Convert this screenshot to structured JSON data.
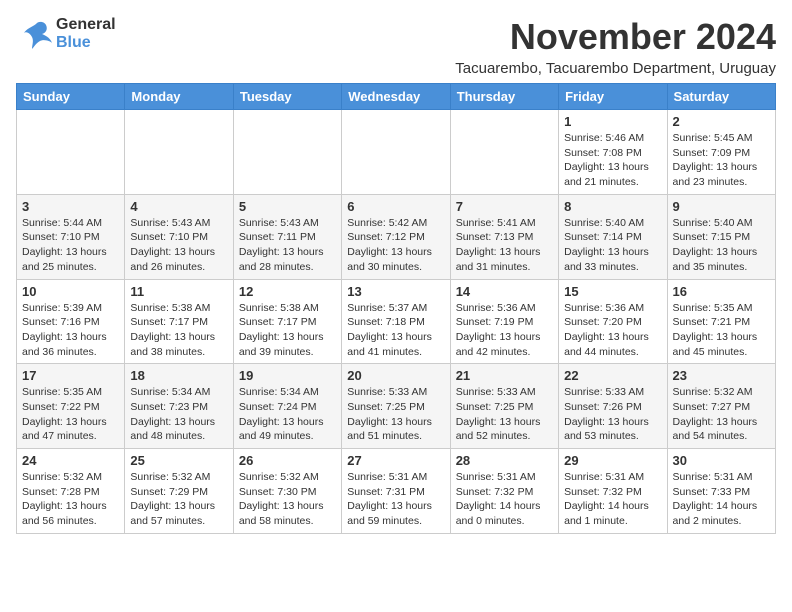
{
  "logo": {
    "line1": "General",
    "line2": "Blue"
  },
  "title": "November 2024",
  "subtitle": "Tacuarembo, Tacuarembo Department, Uruguay",
  "days_of_week": [
    "Sunday",
    "Monday",
    "Tuesday",
    "Wednesday",
    "Thursday",
    "Friday",
    "Saturday"
  ],
  "weeks": [
    [
      {
        "day": "",
        "info": ""
      },
      {
        "day": "",
        "info": ""
      },
      {
        "day": "",
        "info": ""
      },
      {
        "day": "",
        "info": ""
      },
      {
        "day": "",
        "info": ""
      },
      {
        "day": "1",
        "info": "Sunrise: 5:46 AM\nSunset: 7:08 PM\nDaylight: 13 hours\nand 21 minutes."
      },
      {
        "day": "2",
        "info": "Sunrise: 5:45 AM\nSunset: 7:09 PM\nDaylight: 13 hours\nand 23 minutes."
      }
    ],
    [
      {
        "day": "3",
        "info": "Sunrise: 5:44 AM\nSunset: 7:10 PM\nDaylight: 13 hours\nand 25 minutes."
      },
      {
        "day": "4",
        "info": "Sunrise: 5:43 AM\nSunset: 7:10 PM\nDaylight: 13 hours\nand 26 minutes."
      },
      {
        "day": "5",
        "info": "Sunrise: 5:43 AM\nSunset: 7:11 PM\nDaylight: 13 hours\nand 28 minutes."
      },
      {
        "day": "6",
        "info": "Sunrise: 5:42 AM\nSunset: 7:12 PM\nDaylight: 13 hours\nand 30 minutes."
      },
      {
        "day": "7",
        "info": "Sunrise: 5:41 AM\nSunset: 7:13 PM\nDaylight: 13 hours\nand 31 minutes."
      },
      {
        "day": "8",
        "info": "Sunrise: 5:40 AM\nSunset: 7:14 PM\nDaylight: 13 hours\nand 33 minutes."
      },
      {
        "day": "9",
        "info": "Sunrise: 5:40 AM\nSunset: 7:15 PM\nDaylight: 13 hours\nand 35 minutes."
      }
    ],
    [
      {
        "day": "10",
        "info": "Sunrise: 5:39 AM\nSunset: 7:16 PM\nDaylight: 13 hours\nand 36 minutes."
      },
      {
        "day": "11",
        "info": "Sunrise: 5:38 AM\nSunset: 7:17 PM\nDaylight: 13 hours\nand 38 minutes."
      },
      {
        "day": "12",
        "info": "Sunrise: 5:38 AM\nSunset: 7:17 PM\nDaylight: 13 hours\nand 39 minutes."
      },
      {
        "day": "13",
        "info": "Sunrise: 5:37 AM\nSunset: 7:18 PM\nDaylight: 13 hours\nand 41 minutes."
      },
      {
        "day": "14",
        "info": "Sunrise: 5:36 AM\nSunset: 7:19 PM\nDaylight: 13 hours\nand 42 minutes."
      },
      {
        "day": "15",
        "info": "Sunrise: 5:36 AM\nSunset: 7:20 PM\nDaylight: 13 hours\nand 44 minutes."
      },
      {
        "day": "16",
        "info": "Sunrise: 5:35 AM\nSunset: 7:21 PM\nDaylight: 13 hours\nand 45 minutes."
      }
    ],
    [
      {
        "day": "17",
        "info": "Sunrise: 5:35 AM\nSunset: 7:22 PM\nDaylight: 13 hours\nand 47 minutes."
      },
      {
        "day": "18",
        "info": "Sunrise: 5:34 AM\nSunset: 7:23 PM\nDaylight: 13 hours\nand 48 minutes."
      },
      {
        "day": "19",
        "info": "Sunrise: 5:34 AM\nSunset: 7:24 PM\nDaylight: 13 hours\nand 49 minutes."
      },
      {
        "day": "20",
        "info": "Sunrise: 5:33 AM\nSunset: 7:25 PM\nDaylight: 13 hours\nand 51 minutes."
      },
      {
        "day": "21",
        "info": "Sunrise: 5:33 AM\nSunset: 7:25 PM\nDaylight: 13 hours\nand 52 minutes."
      },
      {
        "day": "22",
        "info": "Sunrise: 5:33 AM\nSunset: 7:26 PM\nDaylight: 13 hours\nand 53 minutes."
      },
      {
        "day": "23",
        "info": "Sunrise: 5:32 AM\nSunset: 7:27 PM\nDaylight: 13 hours\nand 54 minutes."
      }
    ],
    [
      {
        "day": "24",
        "info": "Sunrise: 5:32 AM\nSunset: 7:28 PM\nDaylight: 13 hours\nand 56 minutes."
      },
      {
        "day": "25",
        "info": "Sunrise: 5:32 AM\nSunset: 7:29 PM\nDaylight: 13 hours\nand 57 minutes."
      },
      {
        "day": "26",
        "info": "Sunrise: 5:32 AM\nSunset: 7:30 PM\nDaylight: 13 hours\nand 58 minutes."
      },
      {
        "day": "27",
        "info": "Sunrise: 5:31 AM\nSunset: 7:31 PM\nDaylight: 13 hours\nand 59 minutes."
      },
      {
        "day": "28",
        "info": "Sunrise: 5:31 AM\nSunset: 7:32 PM\nDaylight: 14 hours\nand 0 minutes."
      },
      {
        "day": "29",
        "info": "Sunrise: 5:31 AM\nSunset: 7:32 PM\nDaylight: 14 hours\nand 1 minute."
      },
      {
        "day": "30",
        "info": "Sunrise: 5:31 AM\nSunset: 7:33 PM\nDaylight: 14 hours\nand 2 minutes."
      }
    ]
  ]
}
